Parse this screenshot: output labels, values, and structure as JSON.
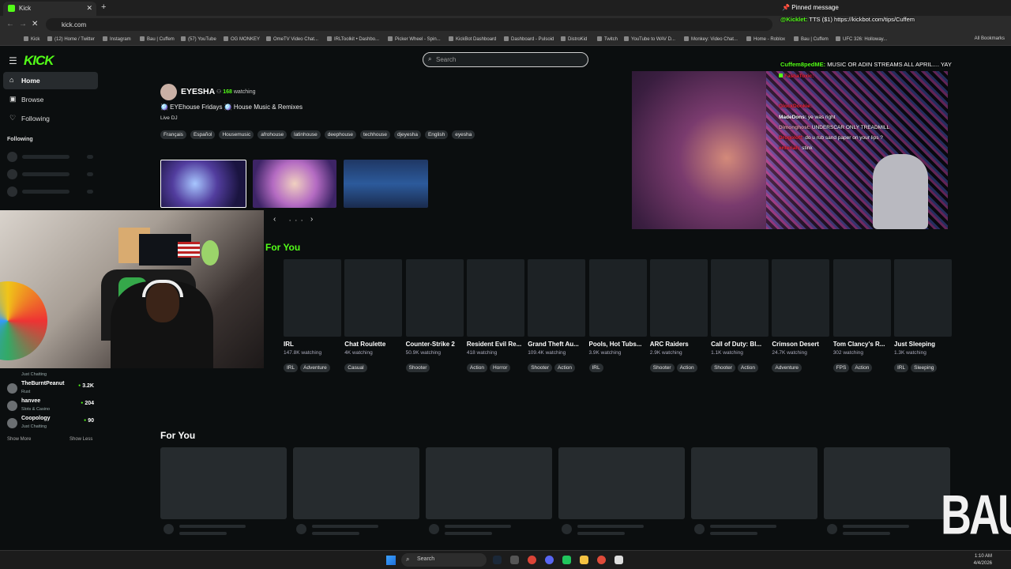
{
  "browser": {
    "tab_title": "Kick",
    "url": "kick.com",
    "bookmarks": [
      "Kick",
      "(12) Home / Twitter",
      "Instagram",
      "Bau | Cuffem",
      "(57) YouTube",
      "OG MONKEY",
      "OmeTV Video Chat...",
      "IRLToolkit • Dashbo...",
      "Picker Wheel - Spin...",
      "KickBot Dashboard",
      "Dashboard - Pulsoid",
      "DistroKid",
      "Twitch",
      "YouTube to WAV D...",
      "Monkey: Video Chat...",
      "Home - Roblox",
      "Bau | Cuffem",
      "UFC 326: Holloway..."
    ],
    "all_bookmarks": "All Bookmarks"
  },
  "header": {
    "logo": "KICK",
    "search_placeholder": "Search"
  },
  "sidebar": {
    "items": [
      {
        "label": "Home",
        "icon": "home-icon"
      },
      {
        "label": "Browse",
        "icon": "browse-icon"
      },
      {
        "label": "Following",
        "icon": "heart-icon"
      }
    ],
    "following_header": "Following",
    "followed": [
      {
        "name": "TheBurntPeanut",
        "category": "Rust",
        "viewers": "3.2K"
      },
      {
        "name": "hanvee",
        "category": "Slots & Casino",
        "viewers": "204"
      },
      {
        "name": "Coopology",
        "category": "Just Chatting",
        "viewers": "90"
      }
    ],
    "partial_category": "Just Chatting",
    "show_more": "Show More",
    "show_less": "Show Less"
  },
  "featured": {
    "streamer": "EYESHA",
    "viewers": "168",
    "viewers_suffix": "watching",
    "title": "🪩 EYEhouse Fridays 🪩 House Music & Remixes",
    "category": "Live DJ",
    "tags": [
      "Français",
      "Español",
      "Housemusic",
      "afrohouse",
      "latinhouse",
      "deephouse",
      "techhouse",
      "djeyesha",
      "English",
      "eyesha"
    ]
  },
  "for_you_title": "For You",
  "categories": [
    {
      "name": "IRL",
      "viewers": "147.8K watching",
      "tags": [
        "IRL",
        "Adventure"
      ]
    },
    {
      "name": "Chat Roulette",
      "viewers": "4K watching",
      "tags": [
        "Casual"
      ]
    },
    {
      "name": "Counter-Strike 2",
      "viewers": "50.9K watching",
      "tags": [
        "Shooter"
      ]
    },
    {
      "name": "Resident Evil Re...",
      "viewers": "418 watching",
      "tags": [
        "Action",
        "Horror"
      ]
    },
    {
      "name": "Grand Theft Au...",
      "viewers": "109.4K watching",
      "tags": [
        "Shooter",
        "Action"
      ]
    },
    {
      "name": "Pools, Hot Tubs...",
      "viewers": "3.9K watching",
      "tags": [
        "IRL"
      ]
    },
    {
      "name": "ARC Raiders",
      "viewers": "2.9K watching",
      "tags": [
        "Shooter",
        "Action"
      ]
    },
    {
      "name": "Call of Duty: Bl...",
      "viewers": "1.1K watching",
      "tags": [
        "Shooter",
        "Action"
      ]
    },
    {
      "name": "Crimson Desert",
      "viewers": "24.7K watching",
      "tags": [
        "Adventure"
      ]
    },
    {
      "name": "Tom Clancy's R...",
      "viewers": "302 watching",
      "tags": [
        "FPS",
        "Action"
      ]
    },
    {
      "name": "Just Sleeping",
      "viewers": "1.3K watching",
      "tags": [
        "IRL",
        "Sleeping"
      ]
    }
  ],
  "for_you_2_title": "For You",
  "chat": {
    "pinned": "Pinned message",
    "pinned_user": "@Kicklet:",
    "pinned_text": "TTS ($1) https://kickbot.com/tips/Cuffem",
    "msg_user": "Cuffem8pedME:",
    "msg_text": "MUSIC OR ADIN STREAMS ALL APRIL.... YAY",
    "overlay": [
      {
        "user": "FashaToxic:",
        "text": ""
      },
      {
        "user": "GlockDookie:",
        "text": ""
      },
      {
        "user": "MadeDons:",
        "text": "ye was right"
      },
      {
        "user": "Dimonghost:",
        "text": "UNDERSCAR ONLY TREADMILL"
      },
      {
        "user": "Drogoloff:",
        "text": "do u rub sand paper on your lips ?"
      },
      {
        "user": "enteriah:",
        "text": "stink"
      }
    ]
  },
  "watermark": "BAU",
  "taskbar": {
    "search": "Search",
    "time": "1:10 AM",
    "date": "4/4/2026"
  }
}
